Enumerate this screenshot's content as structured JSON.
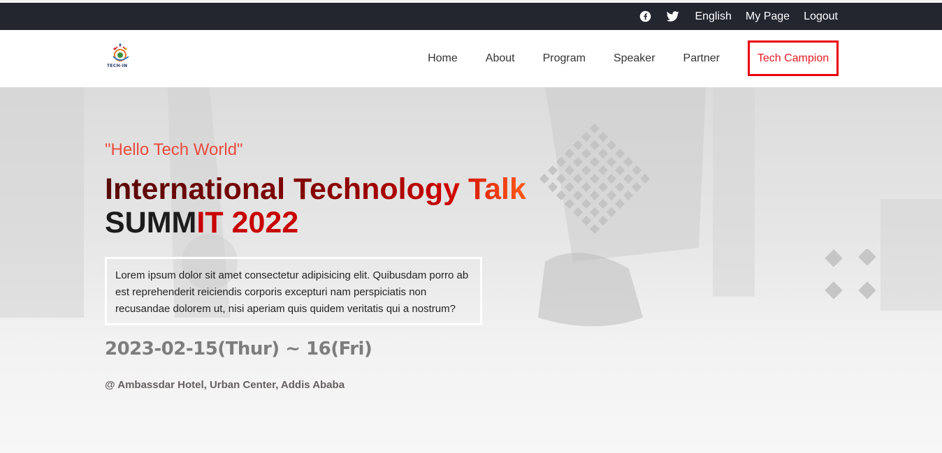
{
  "topbar": {
    "icons": [
      "facebook-icon",
      "twitter-icon"
    ],
    "links": [
      "English",
      "My Page",
      "Logout"
    ]
  },
  "brand": {
    "logo_text": "TECH-IN"
  },
  "nav": {
    "items": [
      "Home",
      "About",
      "Program",
      "Speaker",
      "Partner"
    ],
    "cta": "Tech Campion"
  },
  "hero": {
    "tagline": "\"Hello Tech World\"",
    "title_line1": "International Technology Talk",
    "title_line2a": "SUMM",
    "title_line2b": "IT 2022",
    "description": "Lorem ipsum dolor sit amet consectetur adipisicing elit. Quibusdam porro ab est reprehenderit reiciendis corporis excepturi nam perspiciatis non recusandae dolorem ut, nisi aperiam quis quidem veritatis qui a nostrum?",
    "date": "2023-02-15(Thur) ~ 16(Fri)",
    "venue": "@ Ambassdar Hotel, Urban Center, Addis Ababa"
  },
  "colors": {
    "topbar_bg": "#23252f",
    "accent_red": "#e81b23",
    "tagline": "#ea4c3e"
  }
}
